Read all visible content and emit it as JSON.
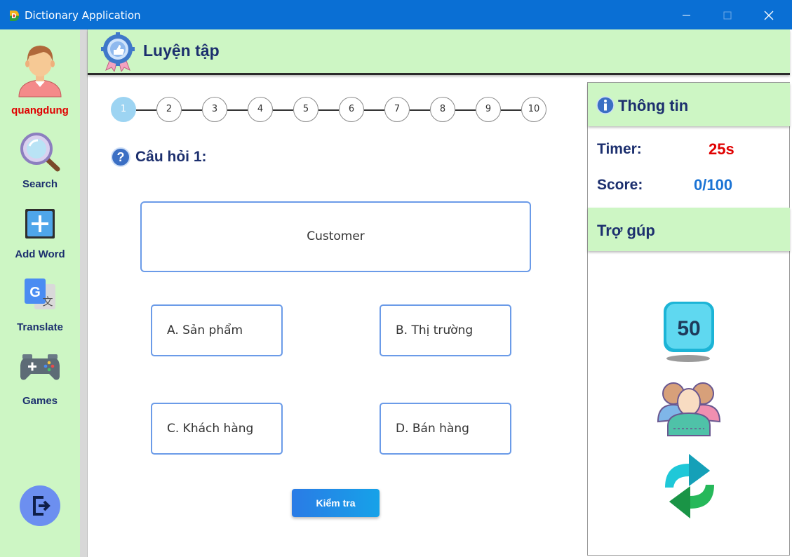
{
  "window": {
    "title": "Dictionary Application"
  },
  "sidebar": {
    "username": "quangdung",
    "items": [
      {
        "label": "Search",
        "icon": "magnifier-icon"
      },
      {
        "label": "Add Word",
        "icon": "plus-icon"
      },
      {
        "label": "Translate",
        "icon": "google-translate-icon"
      },
      {
        "label": "Games",
        "icon": "gamepad-icon"
      }
    ],
    "logout_icon": "logout-icon"
  },
  "header": {
    "title": "Luyện tập",
    "icon": "gear-badge-icon"
  },
  "steps": [
    "1",
    "2",
    "3",
    "4",
    "5",
    "6",
    "7",
    "8",
    "9",
    "10"
  ],
  "current_step": 1,
  "question": {
    "label": "Câu hỏi 1:",
    "word": "Customer"
  },
  "answers": [
    "A. Sản phẩm",
    "B. Thị trường",
    "C. Khách hàng",
    "D. Bán hàng"
  ],
  "check_button": "Kiểm tra",
  "info": {
    "title": "Thông tin",
    "timer_label": "Timer:",
    "timer_value": "25s",
    "score_label": "Score:",
    "score_value": "0/100"
  },
  "help": {
    "title": "Trợ gúp",
    "fifty_label": "50",
    "items": [
      "fifty-fifty-icon",
      "audience-icon",
      "swap-question-icon"
    ]
  },
  "colors": {
    "titlebar": "#0a6fd4",
    "panel_green": "#cdf6c4",
    "navy": "#1c2f6e",
    "red": "#e00000",
    "blue": "#1a73d4"
  }
}
